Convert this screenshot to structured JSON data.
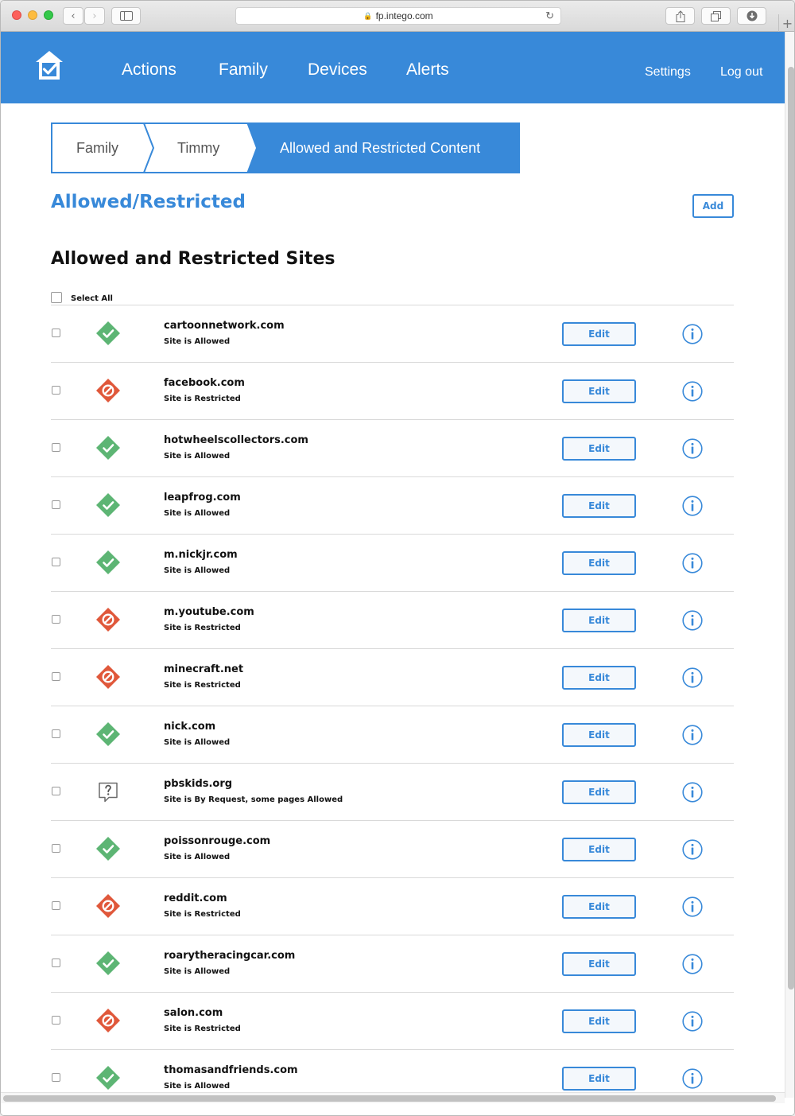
{
  "browser": {
    "url": "fp.intego.com"
  },
  "header": {
    "nav": [
      "Actions",
      "Family",
      "Devices",
      "Alerts"
    ],
    "settings": "Settings",
    "logout": "Log out"
  },
  "breadcrumb": {
    "items": [
      "Family",
      "Timmy",
      "Allowed and Restricted Content"
    ]
  },
  "page": {
    "title": "Allowed/Restricted",
    "add_label": "Add",
    "section_title": "Allowed and Restricted Sites",
    "select_all": "Select All",
    "edit_label": "Edit"
  },
  "colors": {
    "brand": "#3889d9",
    "allowed": "#5db574",
    "restricted": "#e0583b"
  },
  "sites": [
    {
      "domain": "cartoonnetwork.com",
      "status": "Site is Allowed",
      "icon": "allowed"
    },
    {
      "domain": "facebook.com",
      "status": "Site is Restricted",
      "icon": "restricted"
    },
    {
      "domain": "hotwheelscollectors.com",
      "status": "Site is Allowed",
      "icon": "allowed"
    },
    {
      "domain": "leapfrog.com",
      "status": "Site is Allowed",
      "icon": "allowed"
    },
    {
      "domain": "m.nickjr.com",
      "status": "Site is Allowed",
      "icon": "allowed"
    },
    {
      "domain": "m.youtube.com",
      "status": "Site is Restricted",
      "icon": "restricted"
    },
    {
      "domain": "minecraft.net",
      "status": "Site is Restricted",
      "icon": "restricted"
    },
    {
      "domain": "nick.com",
      "status": "Site is Allowed",
      "icon": "allowed"
    },
    {
      "domain": "pbskids.org",
      "status": "Site is By Request, some pages Allowed",
      "icon": "request"
    },
    {
      "domain": "poissonrouge.com",
      "status": "Site is Allowed",
      "icon": "allowed"
    },
    {
      "domain": "reddit.com",
      "status": "Site is Restricted",
      "icon": "restricted"
    },
    {
      "domain": "roarytheracingcar.com",
      "status": "Site is Allowed",
      "icon": "allowed"
    },
    {
      "domain": "salon.com",
      "status": "Site is Restricted",
      "icon": "restricted"
    },
    {
      "domain": "thomasandfriends.com",
      "status": "Site is Allowed",
      "icon": "allowed"
    }
  ]
}
